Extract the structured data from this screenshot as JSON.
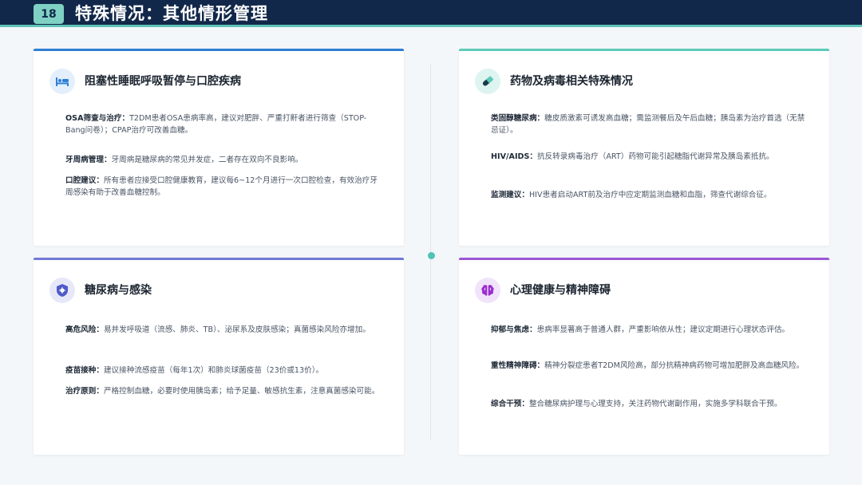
{
  "header": {
    "page_number": "18",
    "title": "特殊情况：其他情形管理"
  },
  "colors": {
    "header_bg": "#12284a",
    "accent_teal": "#5fc4b8",
    "card1_line": "#2f7fd6",
    "card2_line": "#5dcab9",
    "card3_line": "#6f79d9",
    "card4_line": "#9b57d6"
  },
  "cards": [
    {
      "icon": "bed-icon",
      "title": "阻塞性睡眠呼吸暂停与口腔疾病",
      "items": [
        {
          "label": "OSA筛查与治疗：",
          "text": "T2DM患者OSA患病率高，建议对肥胖、严重打鼾者进行筛查（STOP-Bang问卷）；CPAP治疗可改善血糖。"
        },
        {
          "label": "牙周病管理：",
          "text": "牙周病是糖尿病的常见并发症，二者存在双向不良影响。"
        },
        {
          "label": "口腔建议：",
          "text": "所有患者应接受口腔健康教育，建议每6~12个月进行一次口腔检查，有效治疗牙周感染有助于改善血糖控制。"
        }
      ]
    },
    {
      "icon": "pill-icon",
      "title": "药物及病毒相关特殊情况",
      "items": [
        {
          "label": "类固醇糖尿病：",
          "text": "糖皮质激素可诱发高血糖；需监测餐后及午后血糖；胰岛素为治疗首选（无禁忌证）。"
        },
        {
          "label": "HIV/AIDS：",
          "text": "抗反转录病毒治疗（ART）药物可能引起糖脂代谢异常及胰岛素抵抗。"
        },
        {
          "label": "监测建议：",
          "text": "HIV患者启动ART前及治疗中应定期监测血糖和血脂，筛查代谢综合征。"
        }
      ]
    },
    {
      "icon": "shield-virus-icon",
      "title": "糖尿病与感染",
      "items": [
        {
          "label": "高危风险：",
          "text": "易并发呼吸道（流感、肺炎、TB）、泌尿系及皮肤感染；真菌感染风险亦增加。"
        },
        {
          "label": "疫苗接种：",
          "text": "建议接种流感疫苗（每年1次）和肺炎球菌疫苗（23价或13价）。"
        },
        {
          "label": "治疗原则：",
          "text": "严格控制血糖，必要时使用胰岛素；给予足量、敏感抗生素，注意真菌感染可能。"
        }
      ]
    },
    {
      "icon": "brain-icon",
      "title": "心理健康与精神障碍",
      "items": [
        {
          "label": "抑郁与焦虑：",
          "text": "患病率显著高于普通人群，严重影响依从性；建议定期进行心理状态评估。"
        },
        {
          "label": "重性精神障碍：",
          "text": "精神分裂症患者T2DM风险高，部分抗精神病药物可增加肥胖及高血糖风险。"
        },
        {
          "label": "综合干预：",
          "text": "整合糖尿病护理与心理支持，关注药物代谢副作用，实施多学科联合干预。"
        }
      ]
    }
  ]
}
